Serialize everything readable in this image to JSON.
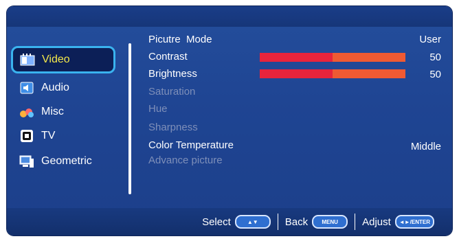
{
  "sidebar": {
    "items": [
      {
        "label": "Video",
        "icon": "video-icon",
        "active": true
      },
      {
        "label": "Audio",
        "icon": "audio-icon",
        "active": false
      },
      {
        "label": "Misc",
        "icon": "misc-icon",
        "active": false
      },
      {
        "label": "TV",
        "icon": "tv-icon",
        "active": false
      },
      {
        "label": "Geometric",
        "icon": "geometric-icon",
        "active": false
      }
    ]
  },
  "settings": {
    "picture_mode": {
      "label": "Picutre  Mode",
      "value": "User"
    },
    "contrast": {
      "label": "Contrast",
      "value": "50",
      "level": 0.5
    },
    "brightness": {
      "label": "Brightness",
      "value": "50",
      "level": 0.5
    },
    "saturation": {
      "label": "Saturation"
    },
    "hue": {
      "label": "Hue"
    },
    "sharpness": {
      "label": "Sharpness"
    },
    "color_temperature": {
      "label": "Color Temperature",
      "value": "Middle"
    },
    "advance_picture": {
      "label": "Advance picture"
    }
  },
  "footer": {
    "select_label": "Select",
    "select_key": "▲▼",
    "back_label": "Back",
    "back_key": "MENU",
    "adjust_label": "Adjust",
    "adjust_key": "◄►/ENTER"
  },
  "colors": {
    "background": "#1f4593",
    "highlight_border": "#3ab3ef",
    "highlight_text": "#f4e84a",
    "bar_fill": "#e8243c",
    "bar_track": "#ef5a33",
    "disabled_text": "#7e8fb9"
  }
}
